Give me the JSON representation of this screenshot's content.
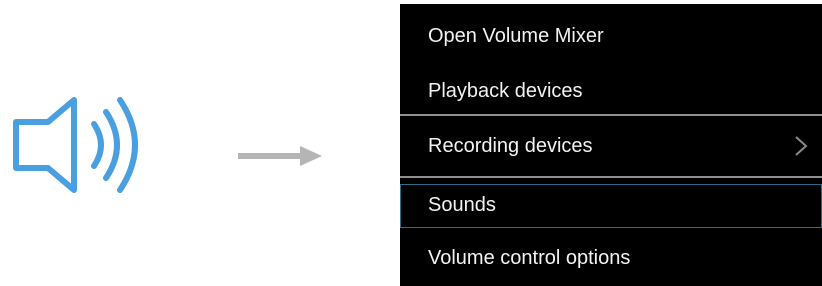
{
  "icons": {
    "speaker": "speaker-volume-icon",
    "arrow": "right-arrow-icon",
    "submenu": "chevron-right-icon"
  },
  "colors": {
    "speaker_blue": "#4a9fe0",
    "arrow_gray": "#b5b5b5",
    "menu_background": "#000000",
    "menu_text": "#f2f2f2",
    "selected_border": "#2f6b86"
  },
  "context_menu": {
    "items": [
      {
        "label": "Open Volume Mixer"
      },
      {
        "label": "Playback devices"
      },
      {
        "label": "Recording devices",
        "has_submenu": true
      },
      {
        "label": "Sounds",
        "selected": true
      },
      {
        "label": "Volume control options"
      }
    ]
  }
}
